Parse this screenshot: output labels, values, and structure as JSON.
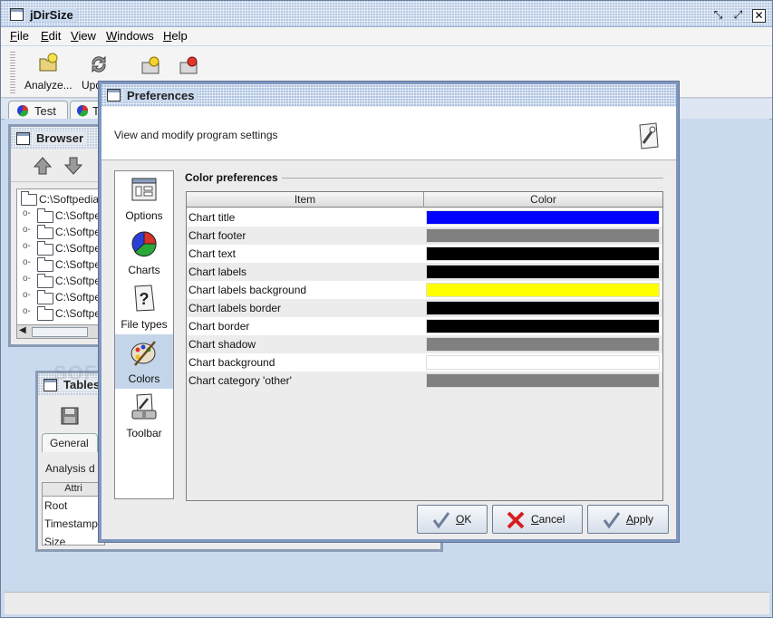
{
  "window": {
    "title": "jDirSize"
  },
  "menu": [
    {
      "label": "File",
      "key": "F",
      "rest": "ile"
    },
    {
      "label": "Edit",
      "key": "E",
      "rest": "dit"
    },
    {
      "label": "View",
      "key": "V",
      "rest": "iew"
    },
    {
      "label": "Windows",
      "key": "W",
      "rest": "indows"
    },
    {
      "label": "Help",
      "key": "H",
      "rest": "elp"
    }
  ],
  "toolbar": {
    "analyze_label": "Analyze...",
    "update_label": "Upd"
  },
  "doc_tabs": [
    {
      "label": "Test"
    },
    {
      "label": "T"
    }
  ],
  "browser": {
    "title": "Browser",
    "root": "C:\\Softpedia",
    "children": [
      "C:\\Softpe",
      "C:\\Softpe",
      "C:\\Softpe",
      "C:\\Softpe",
      "C:\\Softpe",
      "C:\\Softpe",
      "C:\\Softpe"
    ]
  },
  "tables": {
    "title": "Tables",
    "tab_general": "General",
    "analysis_label": "Analysis d",
    "attr_header": "Attri",
    "rows": [
      "Root",
      "Timestamp",
      "Size"
    ]
  },
  "watermark": "SOFTPEDIA",
  "preferences": {
    "title": "Preferences",
    "header_text": "View and modify program settings",
    "categories": [
      {
        "label": "Options",
        "icon": "options-icon"
      },
      {
        "label": "Charts",
        "icon": "pie-chart-icon"
      },
      {
        "label": "File types",
        "icon": "question-mark-icon"
      },
      {
        "label": "Colors",
        "icon": "palette-icon"
      },
      {
        "label": "Toolbar",
        "icon": "toolbar-tools-icon"
      }
    ],
    "selected_category": "Colors",
    "group_title": "Color preferences",
    "columns": {
      "item": "Item",
      "color": "Color"
    },
    "rows": [
      {
        "item": "Chart title",
        "color": "#0000ff"
      },
      {
        "item": "Chart footer",
        "color": "#808080"
      },
      {
        "item": "Chart text",
        "color": "#000000"
      },
      {
        "item": "Chart labels",
        "color": "#000000"
      },
      {
        "item": "Chart labels background",
        "color": "#ffff00"
      },
      {
        "item": "Chart labels border",
        "color": "#000000"
      },
      {
        "item": "Chart border",
        "color": "#000000"
      },
      {
        "item": "Chart shadow",
        "color": "#808080"
      },
      {
        "item": "Chart background",
        "color": "#ffffff"
      },
      {
        "item": "Chart category 'other'",
        "color": "#808080"
      }
    ],
    "buttons": {
      "ok": {
        "key": "O",
        "rest": "K"
      },
      "cancel": {
        "key": "C",
        "rest": "ancel"
      },
      "apply": {
        "key": "A",
        "rest": "pply"
      }
    }
  }
}
